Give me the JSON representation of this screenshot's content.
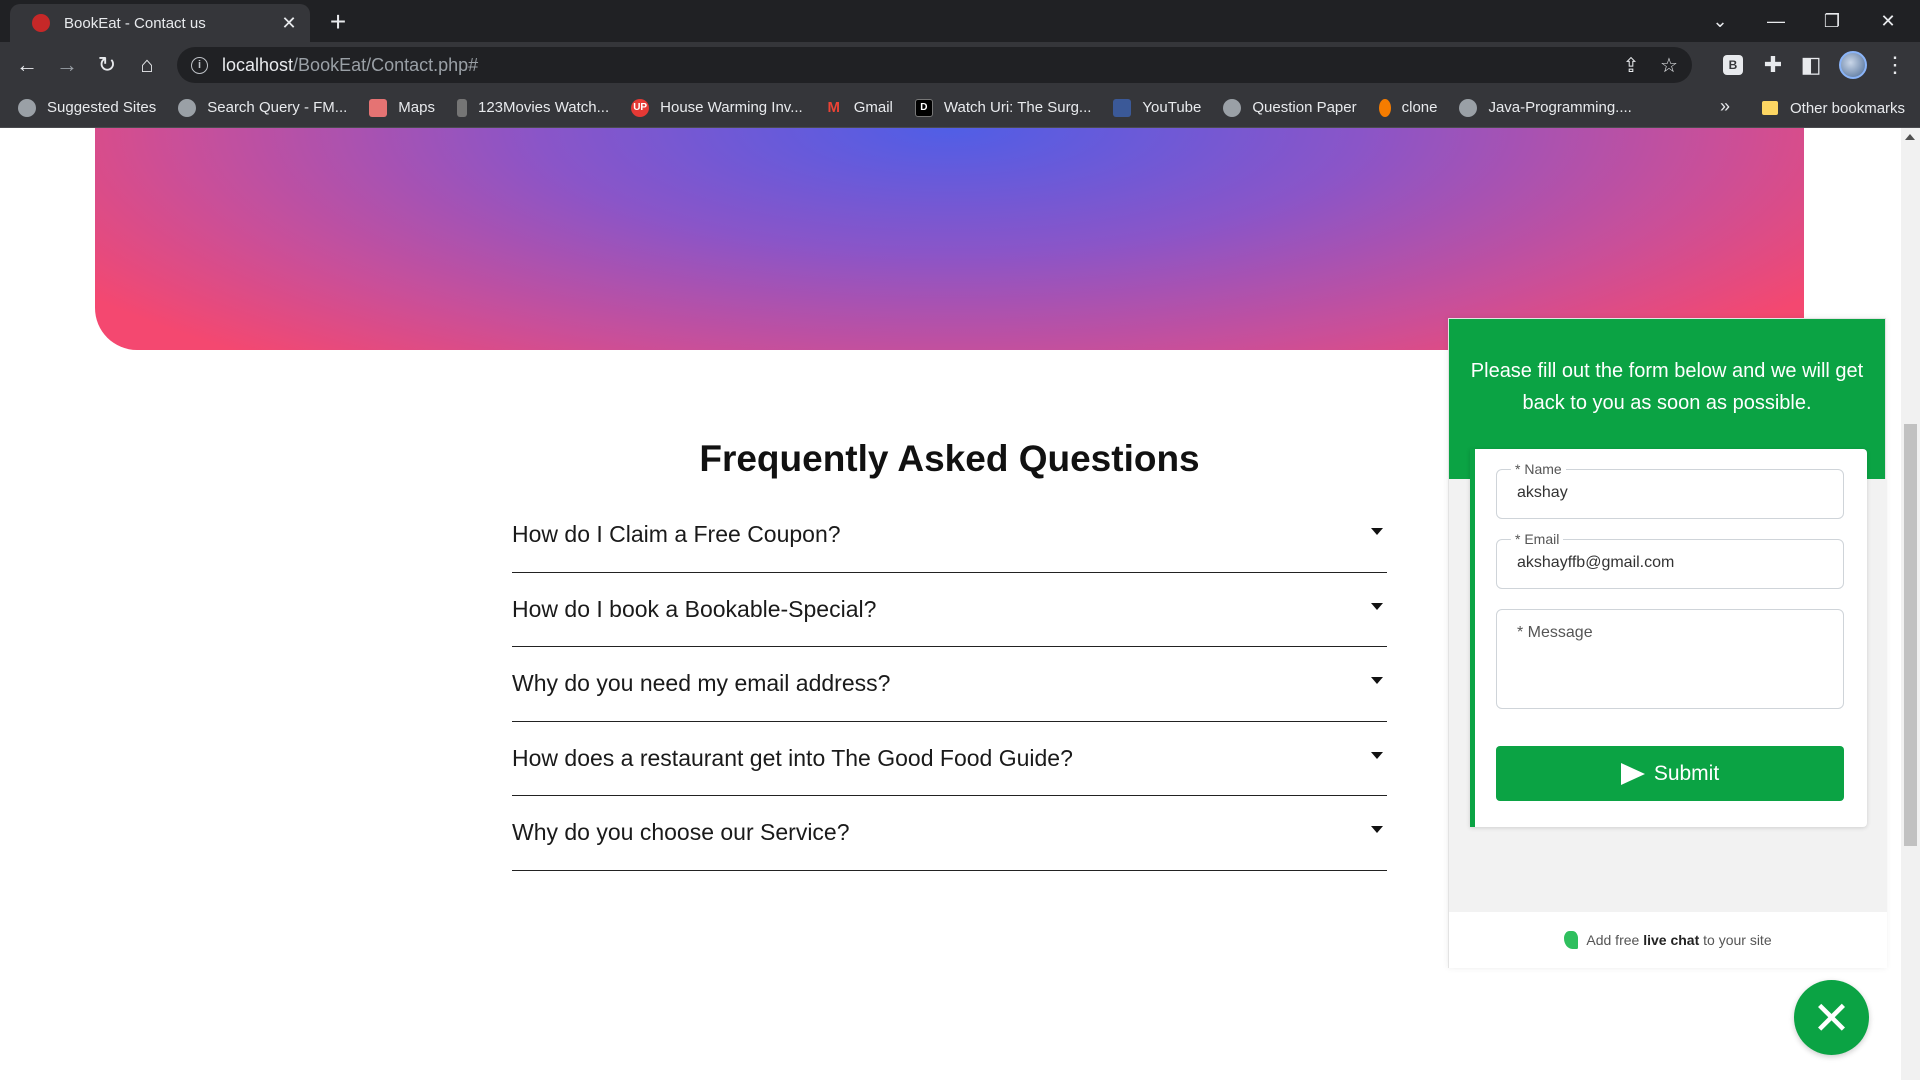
{
  "browser": {
    "tab_title": "BookEat - Contact us",
    "url_host": "localhost",
    "url_path": "/BookEat/Contact.php#",
    "bookmarks": [
      {
        "label": "Suggested Sites",
        "icon": "globe-icon"
      },
      {
        "label": "Search Query - FM...",
        "icon": "globe-icon"
      },
      {
        "label": "Maps",
        "icon": "maps-icon"
      },
      {
        "label": "123Movies Watch...",
        "icon": "movies-icon"
      },
      {
        "label": "House Warming Inv...",
        "icon": "up-icon"
      },
      {
        "label": "Gmail",
        "icon": "gmail-icon"
      },
      {
        "label": "Watch Uri: The Surg...",
        "icon": "d-icon"
      },
      {
        "label": "YouTube",
        "icon": "youtube-icon"
      },
      {
        "label": "Question Paper",
        "icon": "globe-icon"
      },
      {
        "label": "clone",
        "icon": "clone-icon"
      },
      {
        "label": "Java-Programming....",
        "icon": "globe-icon"
      }
    ],
    "bookmarks_overflow": "»",
    "other_bookmarks": "Other bookmarks",
    "extension_letter": "B"
  },
  "faq": {
    "title": "Frequently Asked Questions",
    "items": [
      "How do I Claim a Free Coupon?",
      "How do I book a Bookable-Special?",
      "Why do you need my email address?",
      "How does a restaurant get into The Good Food Guide?",
      "Why do you choose our Service?"
    ]
  },
  "chat": {
    "header_text": "Please fill out the form below and we will get back to you as soon as possible.",
    "name_label": "* Name",
    "name_value": "akshay",
    "email_label": "* Email",
    "email_value": "akshayffb@gmail.com",
    "message_placeholder": "* Message",
    "submit_label": "Submit",
    "footer_prefix": "Add free ",
    "footer_bold": "live chat",
    "footer_suffix": " to your site",
    "close_symbol": "✕"
  },
  "colors": {
    "accent_green": "#0ba344",
    "hero_gradient": [
      "#505ee6",
      "#8a55c8",
      "#c94f99",
      "#f44870"
    ]
  }
}
